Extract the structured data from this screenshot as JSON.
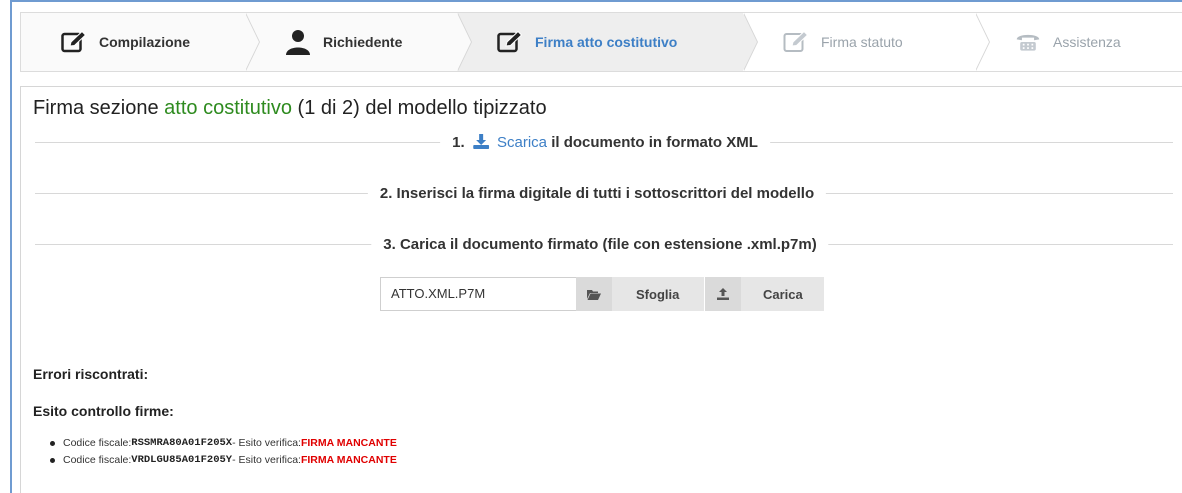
{
  "steps": [
    {
      "label": "Compilazione",
      "icon": "edit-icon",
      "state": "done"
    },
    {
      "label": "Richiedente",
      "icon": "user-icon",
      "state": "done"
    },
    {
      "label": "Firma atto costitutivo",
      "icon": "edit-icon",
      "state": "active"
    },
    {
      "label": "Firma statuto",
      "icon": "edit-icon",
      "state": "disabled"
    },
    {
      "label": "Assistenza",
      "icon": "phone-icon",
      "state": "disabled"
    }
  ],
  "title": {
    "prefix": "Firma sezione ",
    "accent": "atto costitutivo",
    "suffix": " (1 di 2) del modello tipizzato"
  },
  "instructions": {
    "step1": {
      "number": "1.",
      "icon": "download-icon",
      "link": "Scarica",
      "text": " il documento in formato XML"
    },
    "step2": "2. Inserisci la firma digitale di tutti i sottoscrittori del modello",
    "step3": "3. Carica il documento firmato (file con estensione .xml.p7m)"
  },
  "upload": {
    "file_value": "ATTO.XML.P7M",
    "browse_label": "Sfoglia",
    "upload_label": "Carica"
  },
  "errors_label": "Errori riscontrati:",
  "check_label": "Esito controllo firme:",
  "results": [
    {
      "prefix": "Codice fiscale: ",
      "code": "RSSMRA80A01F205X",
      "middle": " - Esito verifica: ",
      "status": "FIRMA MANCANTE"
    },
    {
      "prefix": "Codice fiscale: ",
      "code": "VRDLGU85A01F205Y",
      "middle": " - Esito verifica: ",
      "status": "FIRMA MANCANTE"
    }
  ],
  "colors": {
    "accent": "#2e8b1f",
    "link": "#3d7fc6",
    "error": "#e00000"
  }
}
